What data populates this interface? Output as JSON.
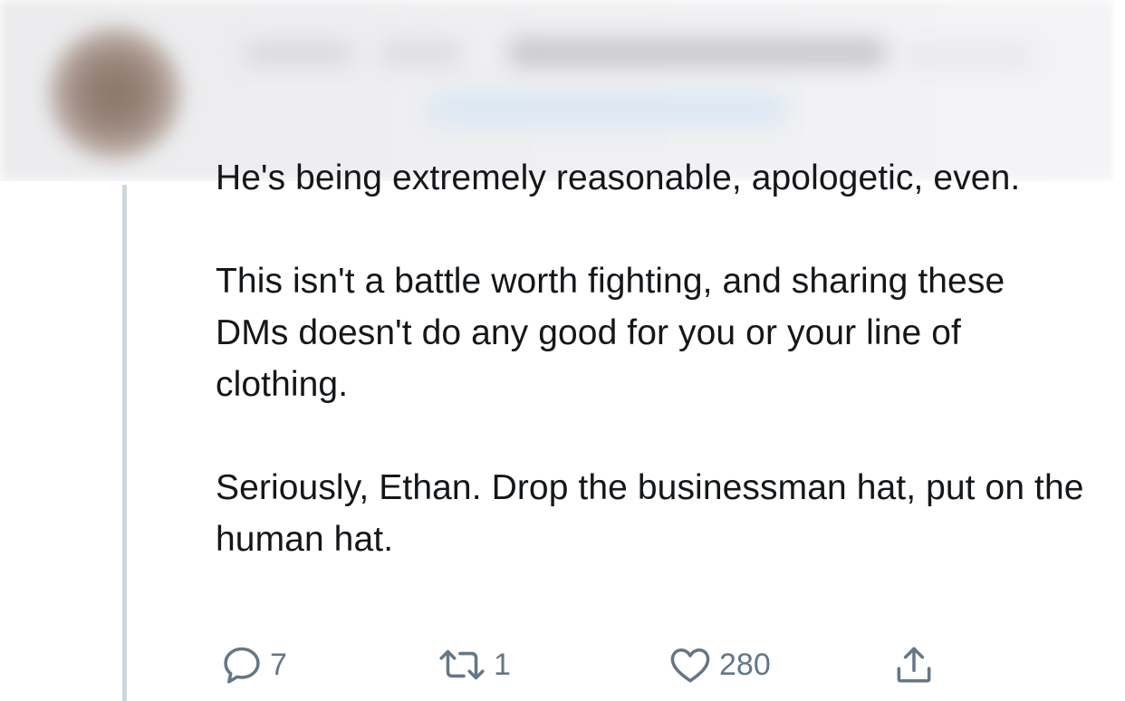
{
  "tweet": {
    "paragraphs": [
      "He's being extremely reasonable, apologetic, even.",
      "This isn't a battle worth fighting, and sharing these DMs doesn't do any good for you or your line of clothing.",
      "Seriously, Ethan. Drop the businessman hat, put on the human hat."
    ],
    "actions": {
      "reply_count": "7",
      "retweet_count": "1",
      "like_count": "280"
    }
  },
  "icons": {
    "reply": "reply-icon",
    "retweet": "retweet-icon",
    "like": "heart-icon",
    "share": "share-icon"
  },
  "colors": {
    "text": "#14171a",
    "icon": "#657786",
    "thread_line": "#ccd6dd"
  }
}
